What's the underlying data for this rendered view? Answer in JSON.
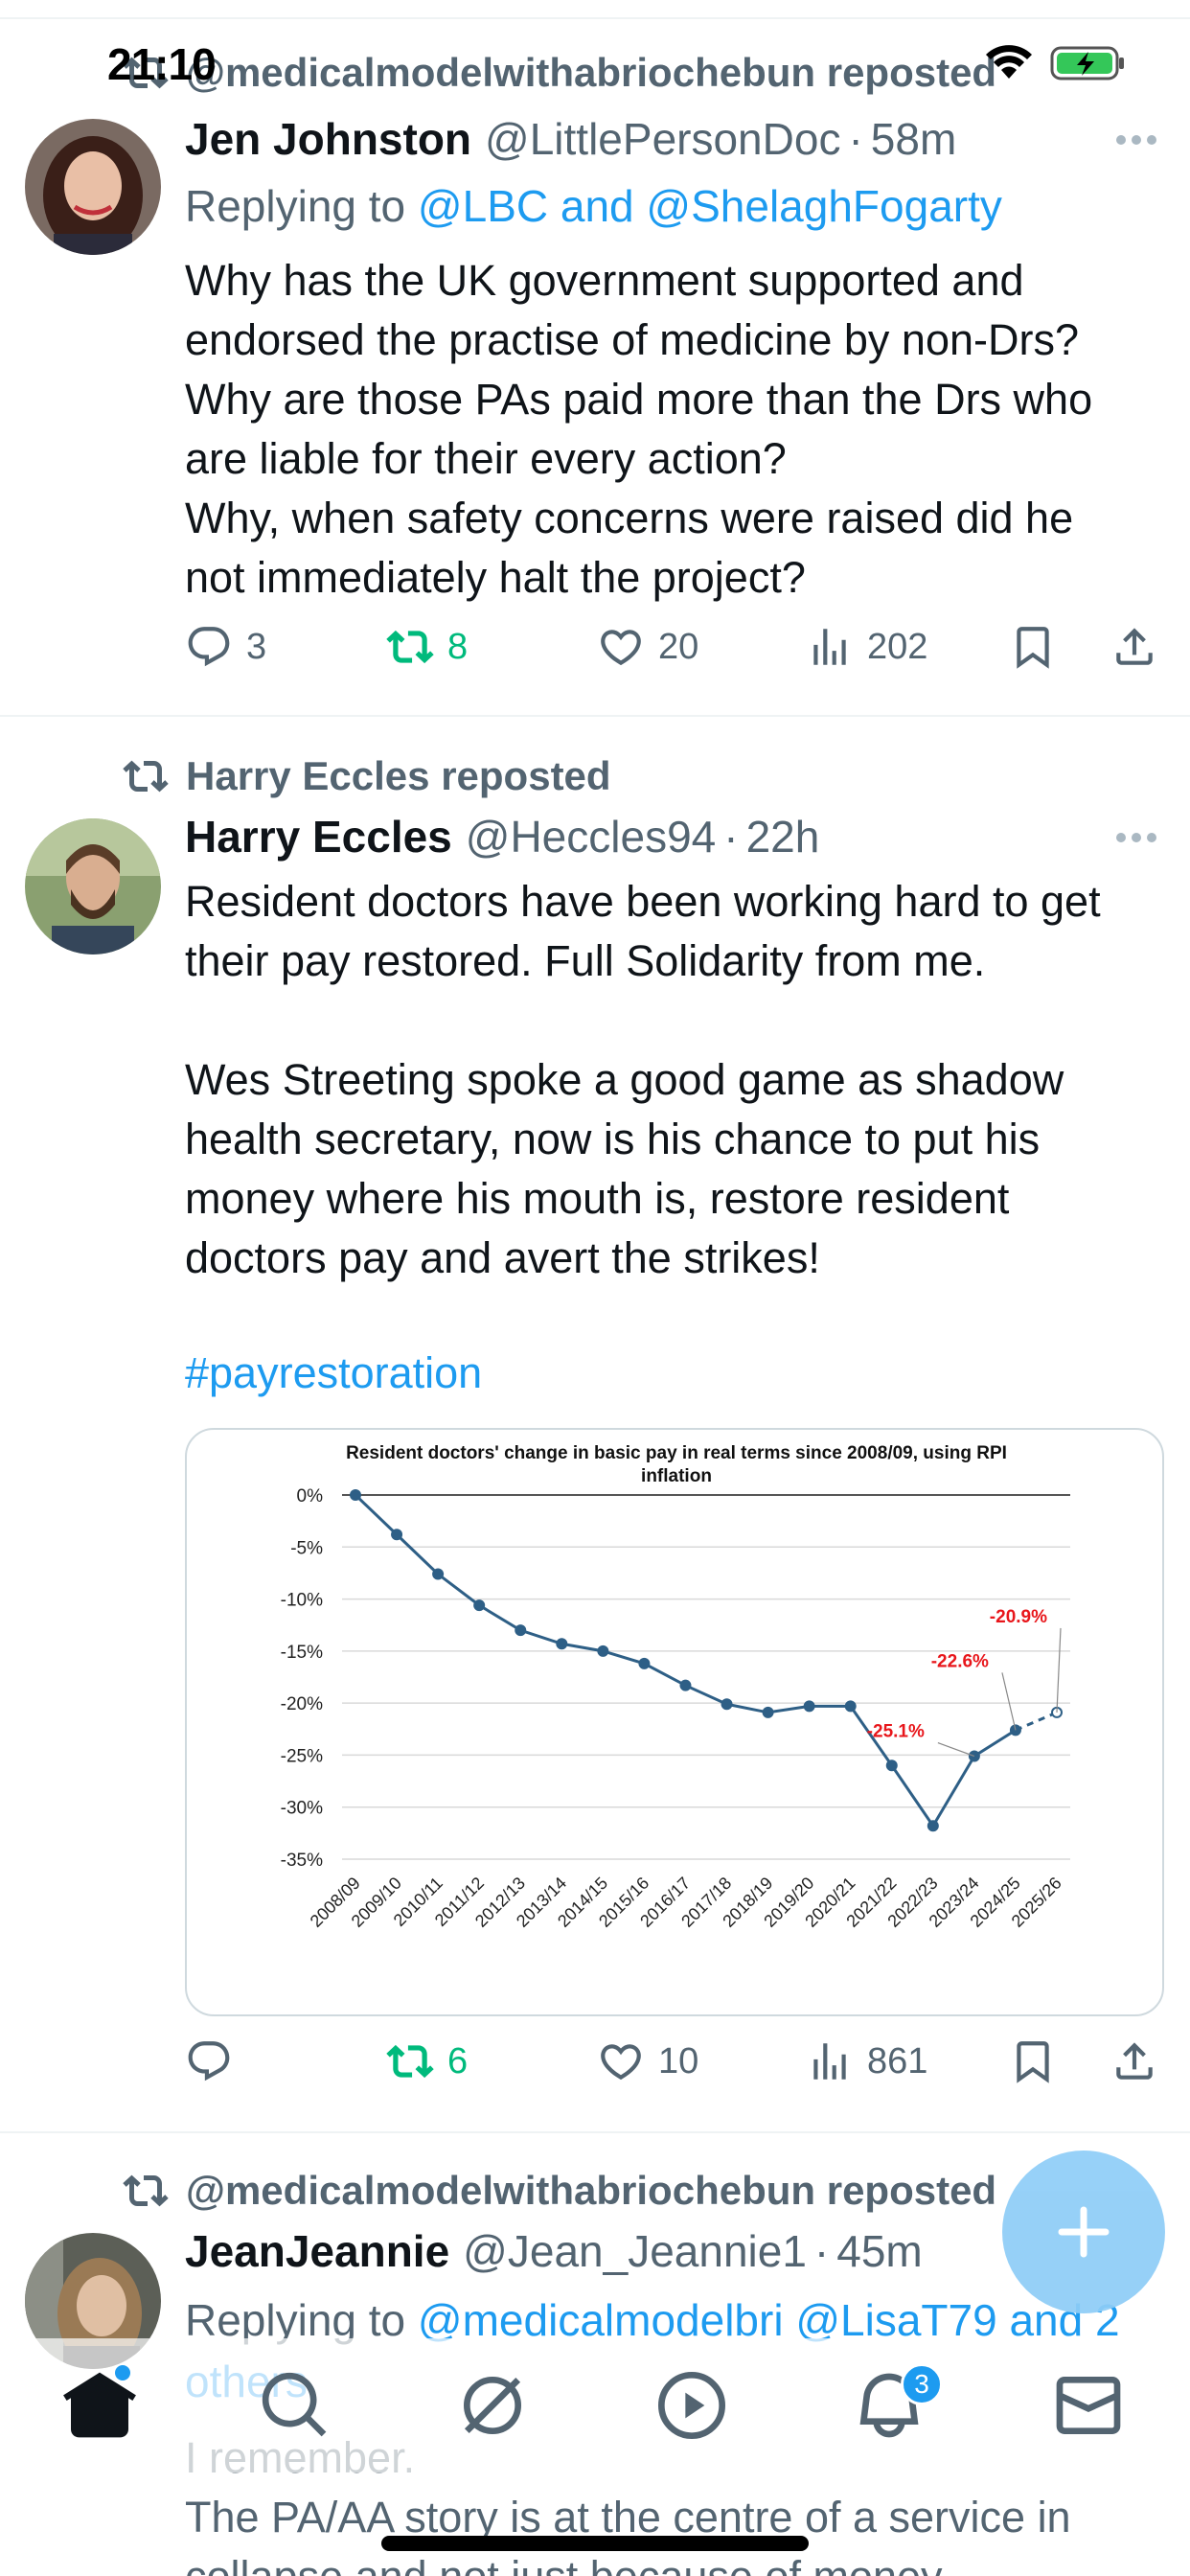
{
  "status_bar": {
    "time": "21:10"
  },
  "tweets": [
    {
      "repost_label": "@medicalmodelwithabriochebun reposted",
      "name": "Jen Johnston",
      "handle": "@LittlePersonDoc",
      "time": "58m",
      "replying_prefix": "Replying to ",
      "replying_to": "@LBC and @ShelaghFogarty",
      "text": "Why has the UK government supported and\nendorsed the practise of medicine by non-Drs?\nWhy are those PAs paid more than the Drs who\nare liable for their every action?\nWhy, when safety concerns were raised did he\nnot immediately halt the project?",
      "replies": "3",
      "reposts": "8",
      "likes": "20",
      "views": "202"
    },
    {
      "repost_label": "Harry Eccles reposted",
      "name": "Harry Eccles",
      "handle": "@Heccles94",
      "time": "22h",
      "text": "Resident doctors have been working hard to get\ntheir pay restored. Full Solidarity from me.\n\nWes Streeting spoke a good game as shadow\nhealth secretary, now is his chance to put his\nmoney where his mouth is, restore resident\ndoctors pay and avert the strikes!",
      "hashtag": "#payrestoration",
      "replies": "",
      "reposts": "6",
      "likes": "10",
      "views": "861"
    },
    {
      "repost_label": "@medicalmodelwithabriochebun reposted",
      "name": "JeanJeannie",
      "handle": "@Jean_Jeannie1",
      "time": "45m",
      "replying_prefix": "Replying to ",
      "replying_to": "@medicalmodelbri @LisaT79 and 2",
      "replying_to_cont": "others",
      "text": "I remember.\nThe PA/AA story is at the centre of a service in\ncollapse and not just because of money"
    }
  ],
  "chart_data": {
    "type": "line",
    "title": "Resident doctors' change in basic pay in real terms since 2008/09, using RPI inflation",
    "categories": [
      "2008/09",
      "2009/10",
      "2010/11",
      "2011/12",
      "2012/13",
      "2013/14",
      "2014/15",
      "2015/16",
      "2016/17",
      "2017/18",
      "2018/19",
      "2019/20",
      "2020/21",
      "2021/22",
      "2022/23",
      "2023/24",
      "2024/25",
      "2025/26"
    ],
    "values": [
      0,
      -3.8,
      -7.6,
      -10.6,
      -13.0,
      -14.3,
      -15.0,
      -16.2,
      -18.3,
      -20.1,
      -20.9,
      -20.3,
      -20.3,
      -26.0,
      -31.8,
      -25.1,
      -22.6,
      -20.9
    ],
    "dashed_from_index": 16,
    "y_ticks": [
      "0%",
      "-5%",
      "-10%",
      "-15%",
      "-20%",
      "-25%",
      "-30%",
      "-35%"
    ],
    "ylim": [
      -35,
      0
    ],
    "grid": true,
    "annotations": [
      {
        "label": "-25.1%",
        "index": 15,
        "value": -25.1
      },
      {
        "label": "-22.6%",
        "index": 16,
        "value": -22.6
      },
      {
        "label": "-20.9%",
        "index": 17,
        "value": -20.9
      }
    ],
    "colors": {
      "line": "#2e5f86",
      "annotation": "#e8161b",
      "grid": "#d9d9d9"
    }
  },
  "tab_bar": {
    "notifications_badge": "3"
  },
  "colors": {
    "accent": "#1d9bf0",
    "repost_green": "#00ba7c",
    "muted": "#536471"
  },
  "icons": [
    "retweet-icon",
    "reply-icon",
    "like-icon",
    "views-icon",
    "bookmark-icon",
    "share-icon",
    "more-icon",
    "home-icon",
    "search-icon",
    "grok-icon",
    "video-icon",
    "notifications-icon",
    "messages-icon",
    "compose-icon",
    "wifi-icon",
    "battery-icon"
  ]
}
